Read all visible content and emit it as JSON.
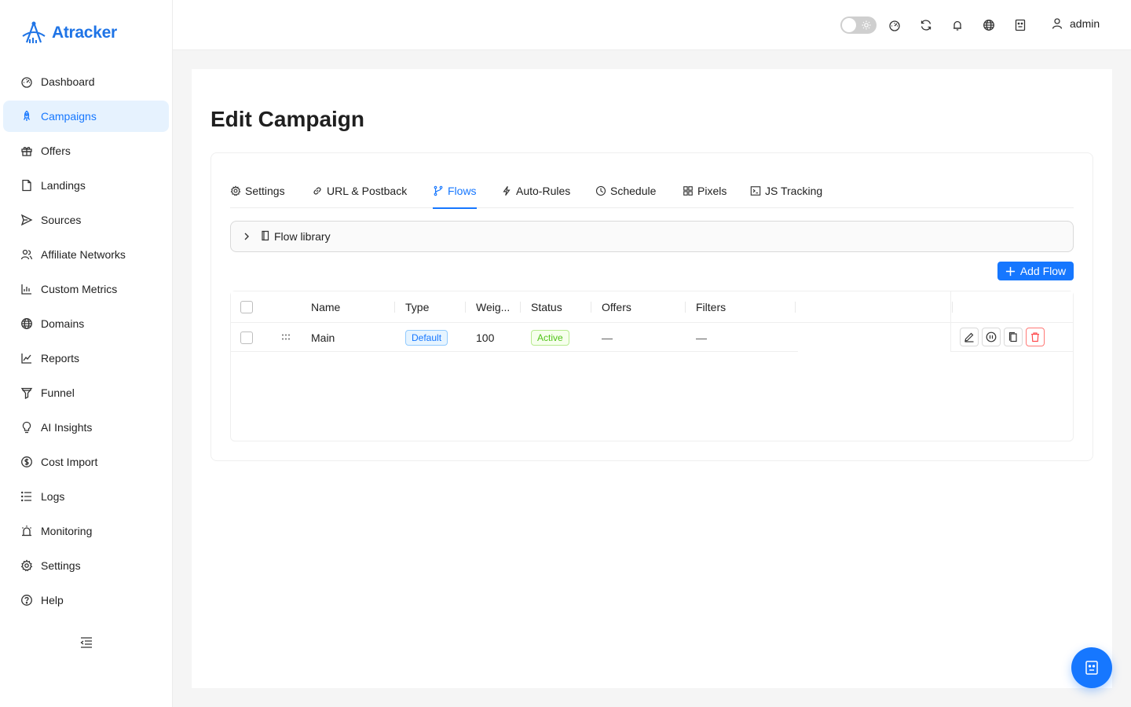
{
  "app": {
    "name": "Atracker",
    "brand_color": "#1677ff"
  },
  "sidebar": {
    "items": [
      {
        "label": "Dashboard",
        "icon": "dashboard-icon"
      },
      {
        "label": "Campaigns",
        "icon": "rocket-icon",
        "active": true
      },
      {
        "label": "Offers",
        "icon": "gift-icon"
      },
      {
        "label": "Landings",
        "icon": "file-icon"
      },
      {
        "label": "Sources",
        "icon": "send-icon"
      },
      {
        "label": "Affiliate Networks",
        "icon": "users-icon"
      },
      {
        "label": "Custom Metrics",
        "icon": "bar-chart-icon"
      },
      {
        "label": "Domains",
        "icon": "globe-icon"
      },
      {
        "label": "Reports",
        "icon": "line-chart-icon"
      },
      {
        "label": "Funnel",
        "icon": "funnel-icon"
      },
      {
        "label": "AI Insights",
        "icon": "bulb-icon"
      },
      {
        "label": "Cost Import",
        "icon": "dollar-icon"
      },
      {
        "label": "Logs",
        "icon": "list-icon"
      },
      {
        "label": "Monitoring",
        "icon": "alarm-icon"
      },
      {
        "label": "Settings",
        "icon": "gear-icon"
      },
      {
        "label": "Help",
        "icon": "question-icon"
      }
    ]
  },
  "header": {
    "user": "admin",
    "icons": [
      "theme-toggle",
      "dashboard-icon",
      "sync-icon",
      "bell-icon",
      "globe-icon",
      "robot-icon",
      "user-icon"
    ]
  },
  "page": {
    "title": "Edit Campaign",
    "tabs": [
      {
        "label": "Settings",
        "icon": "gear-icon"
      },
      {
        "label": "URL & Postback",
        "icon": "link-icon"
      },
      {
        "label": "Flows",
        "icon": "branch-icon",
        "active": true
      },
      {
        "label": "Auto-Rules",
        "icon": "bolt-icon"
      },
      {
        "label": "Schedule",
        "icon": "clock-icon"
      },
      {
        "label": "Pixels",
        "icon": "grid-icon"
      },
      {
        "label": "JS Tracking",
        "icon": "terminal-icon"
      }
    ],
    "flow_library": "Flow library",
    "add_flow": "Add Flow",
    "table": {
      "columns": [
        "Name",
        "Type",
        "Weig...",
        "Status",
        "Offers",
        "Filters"
      ],
      "rows": [
        {
          "name": "Main",
          "type": "Default",
          "weight": "100",
          "status": "Active",
          "offers": "—",
          "filters": "—"
        }
      ]
    }
  }
}
